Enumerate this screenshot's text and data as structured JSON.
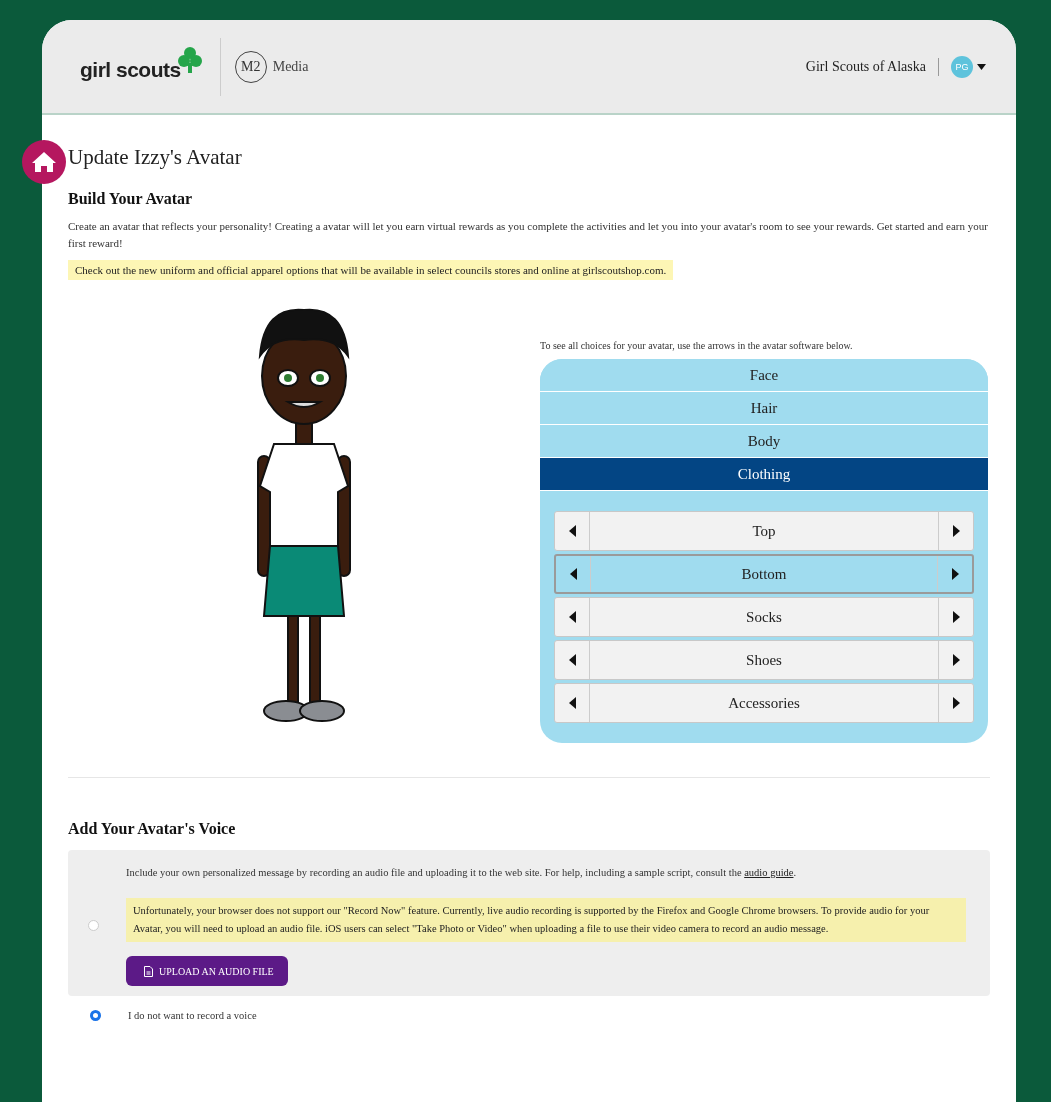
{
  "header": {
    "logo_text": "girl scouts",
    "partner_badge": "M2",
    "partner_label": "Media",
    "council": "Girl Scouts of Alaska",
    "user_initials": "PG"
  },
  "page_title": "Update Izzy's Avatar",
  "build": {
    "heading": "Build Your Avatar",
    "intro": "Create an avatar that reflects your personality!  Creating a avatar will let you earn virtual rewards as you complete the activities and let you into your avatar's room to see your rewards. Get started and earn your first reward!",
    "notice": "Check out the new uniform and official apparel options that will be available in select councils stores and online at girlscoutshop.com."
  },
  "editor": {
    "instructions": "To see all choices for your avatar, use the arrows in the avatar software below.",
    "categories": [
      {
        "label": "Face",
        "selected": false
      },
      {
        "label": "Hair",
        "selected": false
      },
      {
        "label": "Body",
        "selected": false
      },
      {
        "label": "Clothing",
        "selected": true
      }
    ],
    "items": [
      {
        "label": "Top",
        "selected": false
      },
      {
        "label": "Bottom",
        "selected": true
      },
      {
        "label": "Socks",
        "selected": false
      },
      {
        "label": "Shoes",
        "selected": false
      },
      {
        "label": "Accessories",
        "selected": false
      }
    ]
  },
  "voice": {
    "heading": "Add Your Avatar's Voice",
    "options": [
      {
        "kind": "upload",
        "selected": false,
        "description": "Include your own personalized message by recording an audio file and uploading it to the web site. For help, including a sample script, consult the ",
        "link": "audio guide",
        "description_end": ".",
        "warning": "Unfortunately, your browser does not support our \"Record Now\" feature. Currently, live audio recording is supported by the Firefox and Google Chrome browsers. To provide audio for your Avatar, you will need to upload an audio file. iOS users can select \"Take Photo or Video\" when uploading a file to use their video camera to record an audio message.",
        "button": "UPLOAD AN AUDIO FILE"
      },
      {
        "kind": "none",
        "selected": true,
        "label": "I do not want to record a voice"
      }
    ]
  }
}
